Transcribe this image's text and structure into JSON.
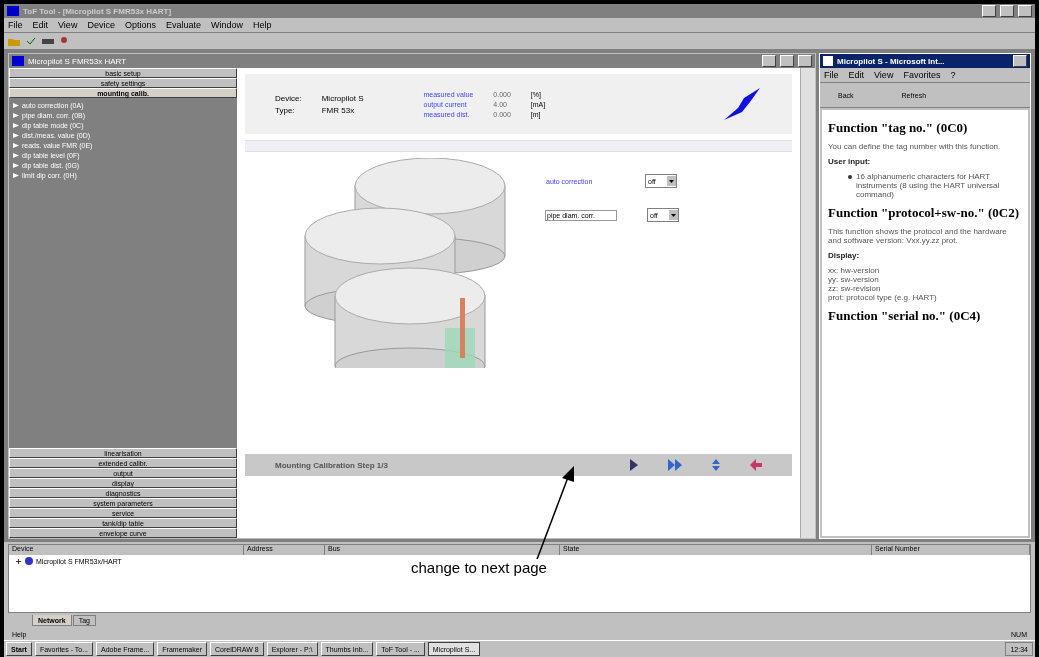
{
  "window": {
    "title": "ToF Tool - [Micropilot S FMR53x HART]"
  },
  "menu": [
    "File",
    "Edit",
    "View",
    "Device",
    "Options",
    "Evaluate",
    "Window",
    "Help"
  ],
  "child_window": {
    "title": "Micropilot S FMR53x HART"
  },
  "sidebar": {
    "top_groups": [
      {
        "label": "basic setup",
        "selected": false
      },
      {
        "label": "safety settings",
        "selected": false
      },
      {
        "label": "mounting calib.",
        "selected": true
      }
    ],
    "items": [
      "auto correction (0A)",
      "pipe diam. corr. (0B)",
      "dip table mode (0C)",
      "dist./meas. value (0D)",
      "reads. value FMR (0E)",
      "dip table level (0F)",
      "dip table dist. (0G)",
      "limit dip corr. (0H)"
    ],
    "bottom_groups": [
      "linearisation",
      "extended calibr.",
      "output",
      "display",
      "diagnostics",
      "system parameters",
      "service",
      "tank/dip table",
      "envelope curve"
    ]
  },
  "header": {
    "device_label": "Device:",
    "device": "Micropilot S",
    "type_label": "Type:",
    "type": "FMR 53x",
    "readings": [
      {
        "label": "measured value",
        "value": "0.000",
        "unit": "[%]"
      },
      {
        "label": "output current",
        "value": "4.00",
        "unit": "[mA]"
      },
      {
        "label": "measured dist.",
        "value": "0.000",
        "unit": "[m]"
      }
    ]
  },
  "params": [
    {
      "label": "auto correction",
      "kind": "link",
      "value": "off"
    },
    {
      "label": "pipe diam. corr.",
      "kind": "field",
      "value": "off"
    }
  ],
  "step_bar": {
    "title": "Mounting Calibration Step 1/3"
  },
  "help_window": {
    "title": "Micropilot S - Microsoft Int...",
    "menu": [
      "File",
      "Edit",
      "View",
      "Favorites",
      "?"
    ],
    "toolbar": [
      "Back",
      "Refresh"
    ],
    "sections": [
      {
        "heading": "Function \"tag no.\" (0C0)",
        "body": [
          "You can define the tag number with this function."
        ],
        "subheading": "User input:",
        "bullets": [
          "16 alphanumeric characters for HART instruments (8 using the HART universal command)"
        ]
      },
      {
        "heading": "Function \"protocol+sw-no.\" (0C2)",
        "body": [
          "This function shows the protocol and the hardware and software version: Vxx.yy.zz prot."
        ],
        "subheading": "Display:",
        "lines": [
          "xx: hw-version",
          "yy: sw-version",
          "zz: sw-revision",
          "prot: protocol type (e.g. HART)"
        ]
      },
      {
        "heading": "Function \"serial no.\" (0C4)"
      }
    ]
  },
  "device_list": {
    "columns": [
      "Device",
      "Address",
      "Bus",
      "State",
      "Serial Number"
    ],
    "rows": [
      {
        "label": "Micropilot S FMR53x/HART",
        "expanded": false
      }
    ],
    "tabs": [
      {
        "label": "Network",
        "selected": true
      },
      {
        "label": "Tag",
        "selected": false
      }
    ]
  },
  "status_bar": {
    "left": "Help",
    "right": "NUM"
  },
  "taskbar": {
    "start": "Start",
    "tasks": [
      {
        "label": "Favorites - To...",
        "selected": false
      },
      {
        "label": "Adobe Frame...",
        "selected": false
      },
      {
        "label": "Framemaker",
        "selected": false
      },
      {
        "label": "CorelDRAW 8",
        "selected": false
      },
      {
        "label": "Explorer - P:\\",
        "selected": false
      },
      {
        "label": "Thumbs Inb...",
        "selected": false
      },
      {
        "label": "ToF Tool - ...",
        "selected": false
      },
      {
        "label": "Micropilot S...",
        "selected": true
      }
    ],
    "clock": "12:34"
  },
  "annotation": {
    "text": "change to next page"
  }
}
